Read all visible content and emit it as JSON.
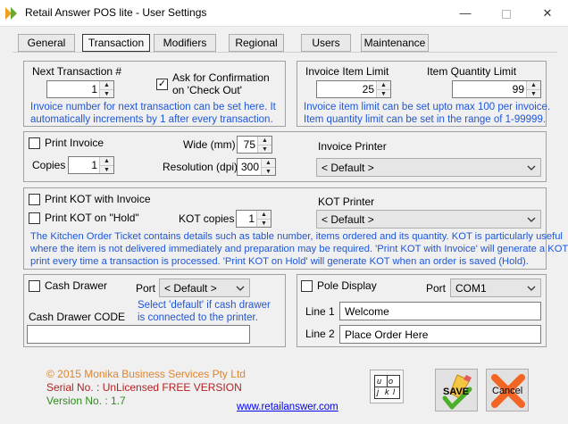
{
  "window": {
    "title": "Retail Answer POS lite - User Settings",
    "minimize_glyph": "—",
    "close_glyph": "✕"
  },
  "tabs": [
    {
      "label": "General"
    },
    {
      "label": "Transaction"
    },
    {
      "label": "Modifiers"
    },
    {
      "label": "Regional"
    },
    {
      "label": "Users"
    },
    {
      "label": "Maintenance"
    }
  ],
  "transaction": {
    "next_label": "Next Transaction #",
    "next_value": "1",
    "confirm_label_1": "Ask for Confirmation",
    "confirm_label_2": "on 'Check Out'",
    "confirm_checked": "✓",
    "note_1": "Invoice number for next transaction can be set here. It",
    "note_2": "automatically increments by 1 after every transaction."
  },
  "limits": {
    "item_limit_label": "Invoice Item Limit",
    "item_limit_value": "25",
    "qty_limit_label": "Item Quantity Limit",
    "qty_limit_value": "99",
    "note_1": "Invoice item limit can be set upto max 100 per invoice.",
    "note_2": "Item quantity limit can be set in the range of 1-99999."
  },
  "invoice": {
    "print_label": "Print Invoice",
    "copies_label": "Copies",
    "copies_value": "1",
    "wide_label": "Wide (mm)",
    "wide_value": "75",
    "resolution_label": "Resolution (dpi)",
    "resolution_value": "300",
    "printer_label": "Invoice Printer",
    "printer_value": "< Default >"
  },
  "kot": {
    "print_with_invoice_label": "Print KOT with Invoice",
    "print_on_hold_label": "Print KOT on \"Hold\"",
    "copies_label": "KOT copies",
    "copies_value": "1",
    "printer_label": "KOT Printer",
    "printer_value": "< Default >",
    "note_1": "The Kitchen Order Ticket contains details such as table number, items ordered and its quantity. KOT is particularly useful",
    "note_2": "where the item is not delivered immediately and preparation may be required. 'Print KOT with Invoice' will generate a KOT",
    "note_3": "print every time a transaction is processed. 'Print KOT on Hold' will generate KOT when an order is saved (Hold)."
  },
  "cash_drawer": {
    "label": "Cash Drawer",
    "port_label": "Port",
    "port_value": "< Default >",
    "note_1": "Select 'default' if cash drawer",
    "note_2": "is connected to the printer.",
    "code_label": "Cash Drawer CODE",
    "code_value": ""
  },
  "pole_display": {
    "label": "Pole Display",
    "port_label": "Port",
    "port_value": "COM1",
    "line1_label": "Line 1",
    "line1_value": "Welcome",
    "line2_label": "Line 2",
    "line2_value": "Place Order Here"
  },
  "footer": {
    "copyright": "© 2015 Monika Business Services Pty Ltd",
    "serial": "Serial No. : UnLicensed FREE VERSION",
    "version": "Version No. : 1.7",
    "link": "www.retailanswer.com",
    "keyboard_keys": [
      "u",
      "o",
      "j",
      "k",
      "l"
    ],
    "save_label": "SAVE",
    "cancel_label": "Cancel"
  },
  "colors": {
    "note_blue": "#1f56d6",
    "copyright_orange": "#e0842c",
    "serial_red": "#b22222",
    "version_green": "#2e8b1e",
    "link_blue": "#0000ee"
  }
}
